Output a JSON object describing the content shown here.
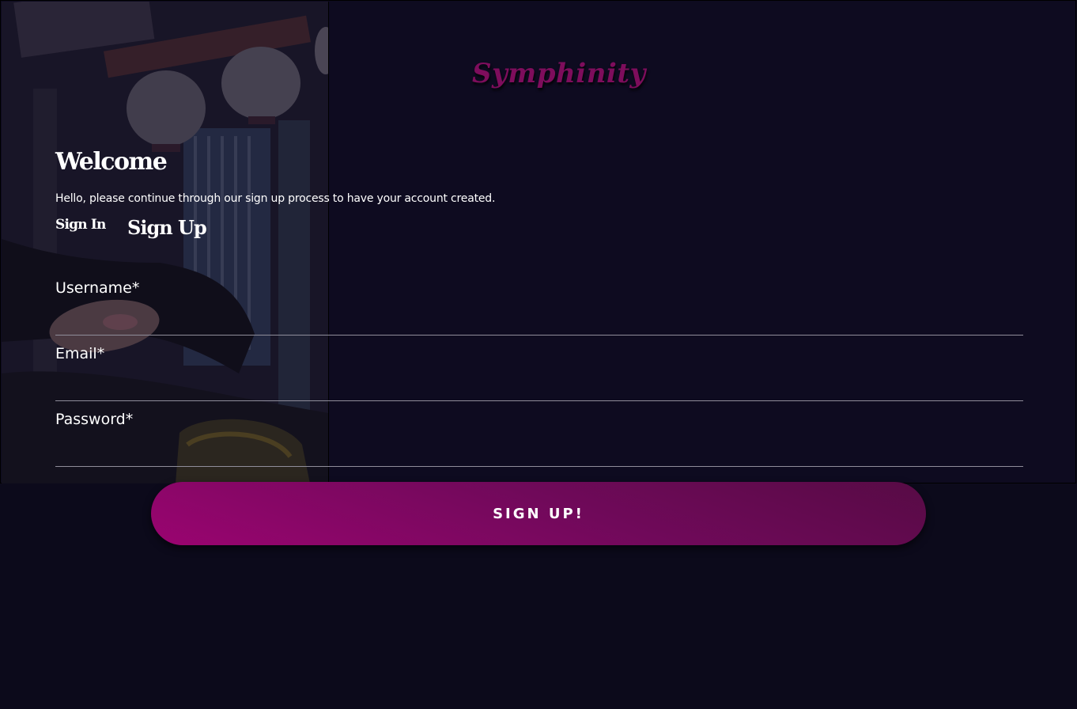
{
  "brand": {
    "logo_text": "Symphinity"
  },
  "header": {
    "title": "Welcome",
    "subtitle": "Hello, please continue through our sign up process to have your account created."
  },
  "tabs": [
    {
      "label": "Sign In",
      "active": false
    },
    {
      "label": "Sign Up",
      "active": true
    }
  ],
  "form": {
    "username_label": "Username*",
    "username_value": "",
    "email_label": "Email*",
    "email_value": "",
    "password_label": "Password*",
    "password_value": "",
    "submit_label": "SIGN UP!"
  },
  "colors": {
    "background": "#0c0a1b",
    "panel": "#0e0b20",
    "accent": "#9a0470",
    "logo": "#7e0d5c",
    "text": "#ffffff",
    "divider": "#8f8d9a"
  }
}
